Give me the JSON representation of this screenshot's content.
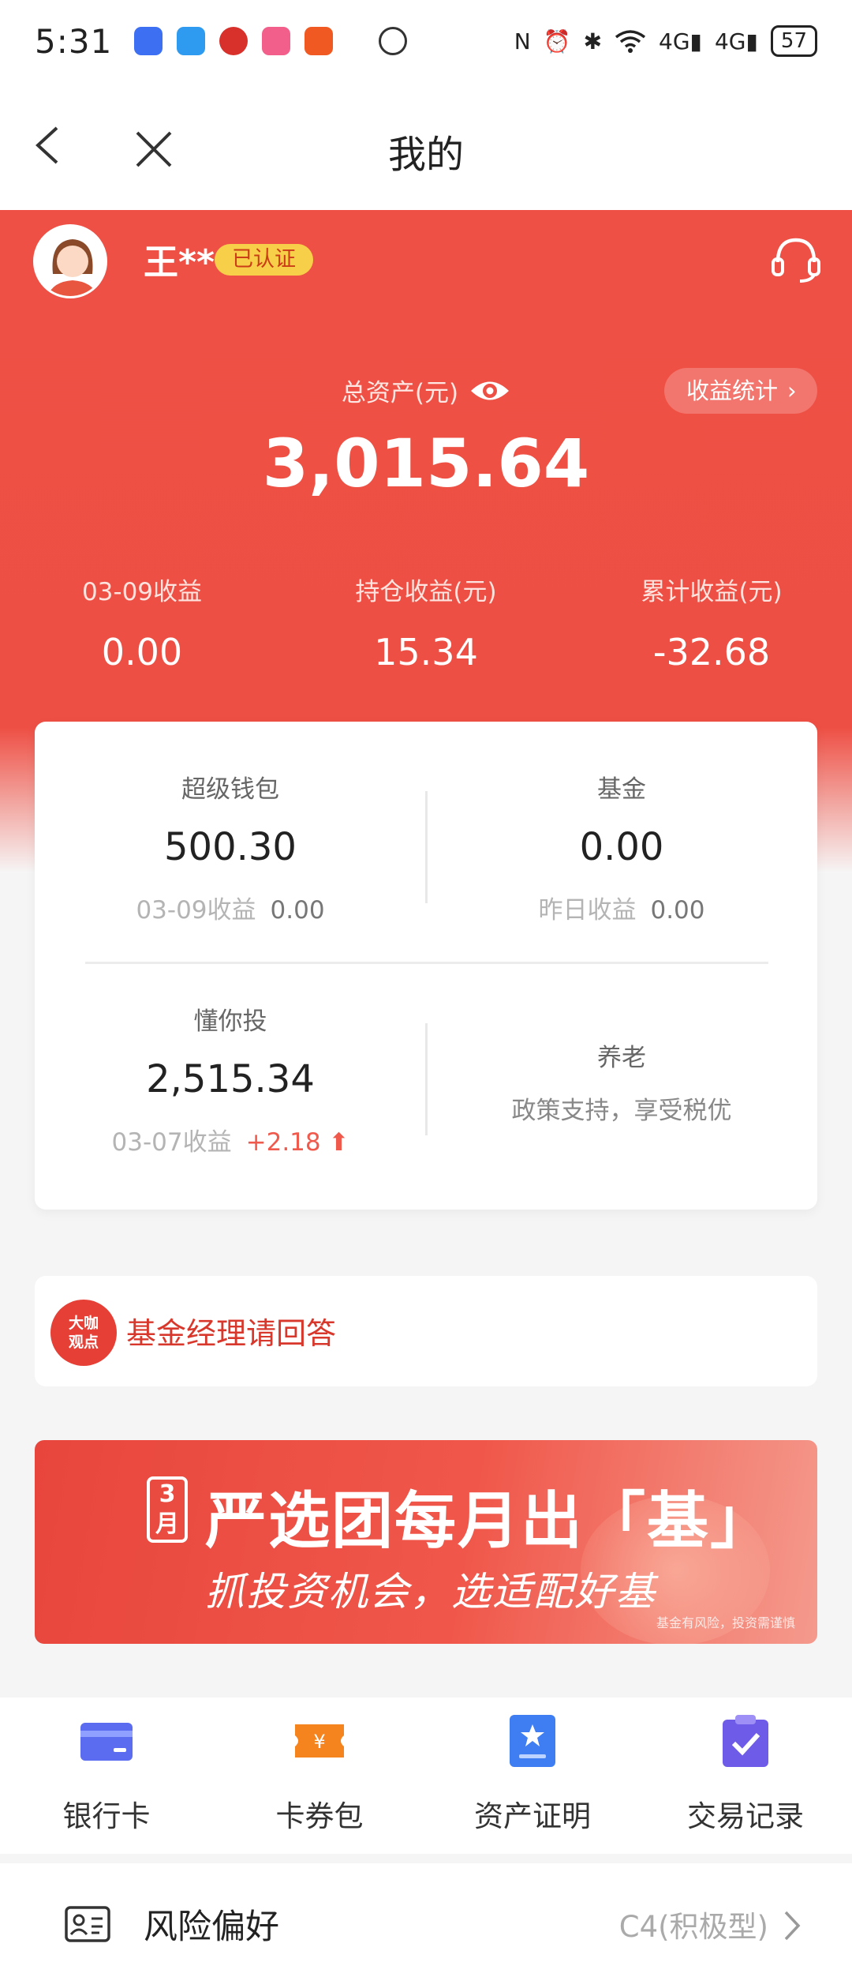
{
  "status_bar": {
    "time": "5:31",
    "battery": "57",
    "network_1": "4G",
    "network_2": "4G"
  },
  "nav": {
    "title": "我的"
  },
  "user": {
    "name": "王**",
    "verified_badge": "已认证"
  },
  "summary": {
    "total_label": "总资产(元)",
    "total_value": "3,015.64",
    "stats_button": "收益统计",
    "metrics": [
      {
        "label": "03-09收益",
        "value": "0.00"
      },
      {
        "label": "持仓收益(元)",
        "value": "15.34"
      },
      {
        "label": "累计收益(元)",
        "value": "-32.68"
      }
    ]
  },
  "assets": {
    "super_wallet": {
      "label": "超级钱包",
      "value": "500.30",
      "sub_label": "03-09收益",
      "sub_value": "0.00"
    },
    "fund": {
      "label": "基金",
      "value": "0.00",
      "sub_label": "昨日收益",
      "sub_value": "0.00"
    },
    "smart_invest": {
      "label": "懂你投",
      "value": "2,515.34",
      "sub_label": "03-07收益",
      "sub_value": "+2.18"
    },
    "pension": {
      "label": "养老",
      "desc": "政策支持，享受税优"
    }
  },
  "fund_manager": {
    "logo_text_1": "大咖",
    "logo_text_2": "观点",
    "text": "基金经理请回答"
  },
  "banner": {
    "month_badge_1": "3",
    "month_badge_2": "月",
    "title": "严选团每月出「基」",
    "subtitle": "抓投资机会，选适配好基",
    "disclaimer": "基金有风险，投资需谨慎"
  },
  "quick_actions": [
    {
      "label": "银行卡",
      "icon": "bank-card-icon",
      "color": "#5b6cf0"
    },
    {
      "label": "卡券包",
      "icon": "coupon-icon",
      "color": "#f5841f"
    },
    {
      "label": "资产证明",
      "icon": "certificate-icon",
      "color": "#3f7ef2"
    },
    {
      "label": "交易记录",
      "icon": "records-icon",
      "color": "#6e5ce8"
    }
  ],
  "risk": {
    "label": "风险偏好",
    "value": "C4(积极型)"
  },
  "colors": {
    "brand_red": "#ef5045",
    "badge_yellow": "#f8cf49",
    "up_red": "#ef5a4c"
  }
}
